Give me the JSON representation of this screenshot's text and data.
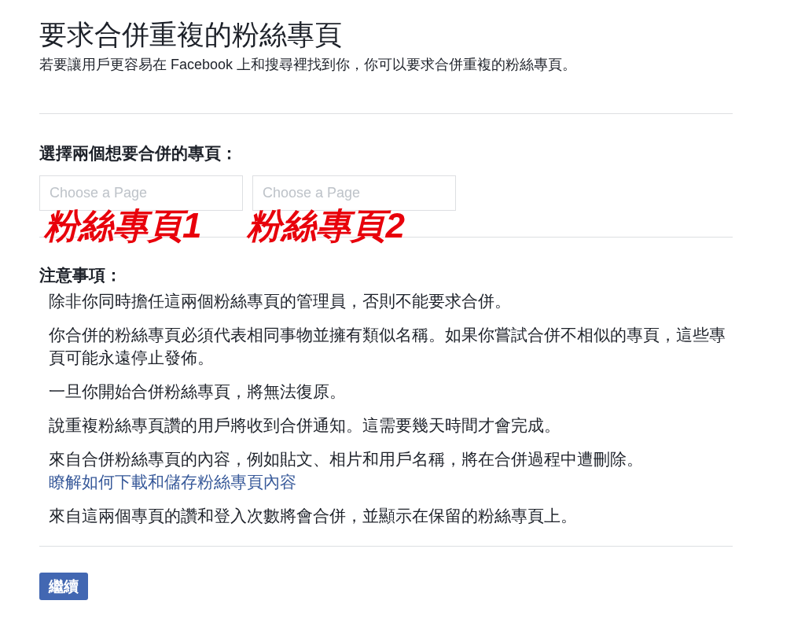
{
  "title": "要求合併重複的粉絲專頁",
  "subtitle": "若要讓用戶更容易在 Facebook 上和搜尋裡找到你，你可以要求合併重複的粉絲專頁。",
  "select_section": {
    "heading": "選擇兩個想要合併的專頁：",
    "fields": [
      {
        "placeholder": "Choose a Page"
      },
      {
        "placeholder": "Choose a Page"
      }
    ],
    "annotations": [
      "粉絲專頁1",
      "粉絲專頁2"
    ]
  },
  "notes": {
    "heading": "注意事項：",
    "items": [
      {
        "text": "除非你同時擔任這兩個粉絲專頁的管理員，否則不能要求合併。"
      },
      {
        "text": "你合併的粉絲專頁必須代表相同事物並擁有類似名稱。如果你嘗試合併不相似的專頁，這些專頁可能永遠停止發佈。"
      },
      {
        "text": "一旦你開始合併粉絲專頁，將無法復原。"
      },
      {
        "text": "說重複粉絲專頁讚的用戶將收到合併通知。這需要幾天時間才會完成。"
      },
      {
        "text": "來自合併粉絲專頁的內容，例如貼文、相片和用戶名稱，將在合併過程中遭刪除。",
        "link": "瞭解如何下載和儲存粉絲專頁內容"
      },
      {
        "text": "來自這兩個專頁的讚和登入次數將會合併，並顯示在保留的粉絲專頁上。"
      }
    ]
  },
  "continue_button": "繼續"
}
